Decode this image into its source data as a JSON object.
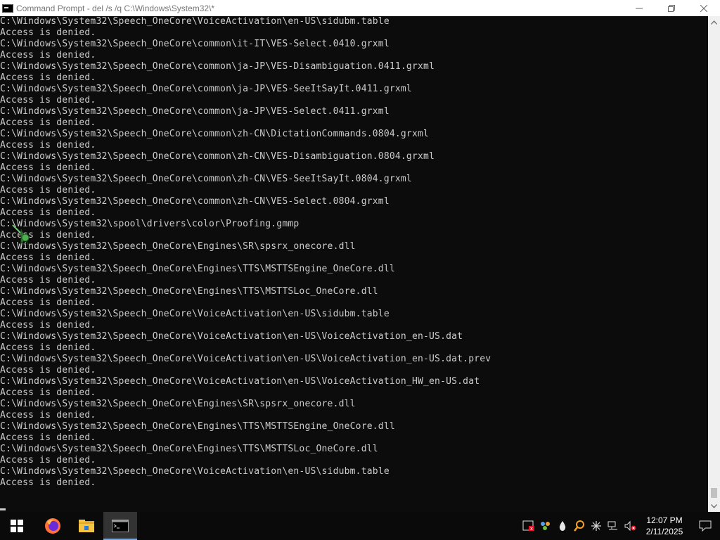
{
  "window": {
    "title": "Command Prompt - del  /s /q C:\\Windows\\System32\\*"
  },
  "console": {
    "lines": [
      "C:\\Windows\\System32\\Speech_OneCore\\VoiceActivation\\en-US\\sidubm.table",
      "Access is denied.",
      "C:\\Windows\\System32\\Speech_OneCore\\common\\it-IT\\VES-Select.0410.grxml",
      "Access is denied.",
      "C:\\Windows\\System32\\Speech_OneCore\\common\\ja-JP\\VES-Disambiguation.0411.grxml",
      "Access is denied.",
      "C:\\Windows\\System32\\Speech_OneCore\\common\\ja-JP\\VES-SeeItSayIt.0411.grxml",
      "Access is denied.",
      "C:\\Windows\\System32\\Speech_OneCore\\common\\ja-JP\\VES-Select.0411.grxml",
      "Access is denied.",
      "C:\\Windows\\System32\\Speech_OneCore\\common\\zh-CN\\DictationCommands.0804.grxml",
      "Access is denied.",
      "C:\\Windows\\System32\\Speech_OneCore\\common\\zh-CN\\VES-Disambiguation.0804.grxml",
      "Access is denied.",
      "C:\\Windows\\System32\\Speech_OneCore\\common\\zh-CN\\VES-SeeItSayIt.0804.grxml",
      "Access is denied.",
      "C:\\Windows\\System32\\Speech_OneCore\\common\\zh-CN\\VES-Select.0804.grxml",
      "Access is denied.",
      "C:\\Windows\\System32\\spool\\drivers\\color\\Proofing.gmmp",
      "Access is denied.",
      "C:\\Windows\\System32\\Speech_OneCore\\Engines\\SR\\spsrx_onecore.dll",
      "Access is denied.",
      "C:\\Windows\\System32\\Speech_OneCore\\Engines\\TTS\\MSTTSEngine_OneCore.dll",
      "Access is denied.",
      "C:\\Windows\\System32\\Speech_OneCore\\Engines\\TTS\\MSTTSLoc_OneCore.dll",
      "Access is denied.",
      "C:\\Windows\\System32\\Speech_OneCore\\VoiceActivation\\en-US\\sidubm.table",
      "Access is denied.",
      "C:\\Windows\\System32\\Speech_OneCore\\VoiceActivation\\en-US\\VoiceActivation_en-US.dat",
      "Access is denied.",
      "C:\\Windows\\System32\\Speech_OneCore\\VoiceActivation\\en-US\\VoiceActivation_en-US.dat.prev",
      "Access is denied.",
      "C:\\Windows\\System32\\Speech_OneCore\\VoiceActivation\\en-US\\VoiceActivation_HW_en-US.dat",
      "Access is denied.",
      "C:\\Windows\\System32\\Speech_OneCore\\Engines\\SR\\spsrx_onecore.dll",
      "Access is denied.",
      "C:\\Windows\\System32\\Speech_OneCore\\Engines\\TTS\\MSTTSEngine_OneCore.dll",
      "Access is denied.",
      "C:\\Windows\\System32\\Speech_OneCore\\Engines\\TTS\\MSTTSLoc_OneCore.dll",
      "Access is denied.",
      "C:\\Windows\\System32\\Speech_OneCore\\VoiceActivation\\en-US\\sidubm.table",
      "Access is denied."
    ]
  },
  "taskbar": {
    "pinned": [
      "start-icon",
      "firefox-icon",
      "file-explorer-icon",
      "command-prompt-icon"
    ],
    "active": "command-prompt-icon"
  },
  "tray": {
    "time": "12:07 PM",
    "date": "2/11/2025"
  },
  "colors": {
    "console_bg": "#0c0c0c",
    "console_text": "#cccccc",
    "titlebar_bg": "#ffffff",
    "taskbar_bg": "#0a0a0a",
    "accent": "#0078d7"
  }
}
